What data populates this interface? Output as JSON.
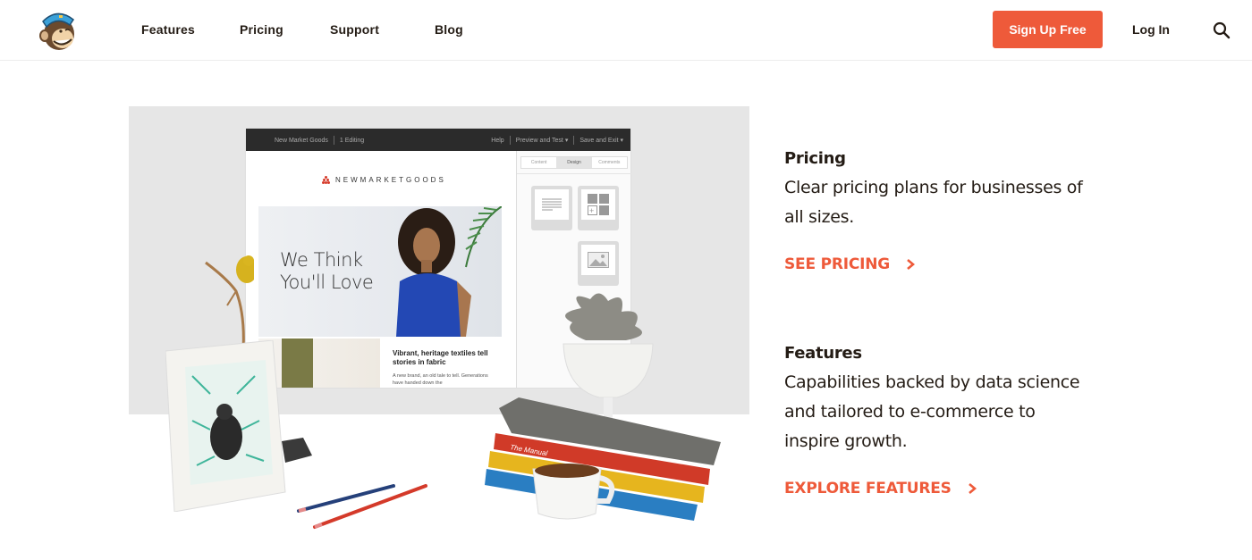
{
  "header": {
    "logo_alt": "Freddie mascot logo",
    "nav": [
      {
        "label": "Features"
      },
      {
        "label": "Pricing"
      },
      {
        "label": "Support"
      },
      {
        "label": "Blog"
      }
    ],
    "signup_label": "Sign Up Free",
    "login_label": "Log In",
    "search_icon": "search-icon"
  },
  "hero": {
    "app_bar": {
      "left": [
        "New Market Goods",
        "1 Editing"
      ],
      "right": [
        "Help",
        "Preview and Test ▾",
        "Save and Exit ▾"
      ]
    },
    "brand": "NEWMARKETGOODS",
    "banner_line1": "We Think",
    "banner_line2": "You'll Love",
    "article_title": "Vibrant, heritage textiles tell stories in fabric",
    "article_body": "A new brand, an old tale to tell. Generations have handed down the",
    "sidebar_tabs": [
      {
        "label": "Content",
        "active": false
      },
      {
        "label": "Design",
        "active": true
      },
      {
        "label": "Comments",
        "active": false
      }
    ],
    "book_label": "The Manual"
  },
  "sections": [
    {
      "title": "Pricing",
      "body": "Clear pricing plans for businesses of all sizes.",
      "link": "SEE PRICING"
    },
    {
      "title": "Features",
      "body": "Capabilities backed by data science and tailored to e-commerce to inspire growth.",
      "link": "EXPLORE FEATURES"
    }
  ],
  "colors": {
    "accent": "#ee5a3a",
    "text": "#241c15",
    "hero_bg": "#e6e6e6"
  }
}
